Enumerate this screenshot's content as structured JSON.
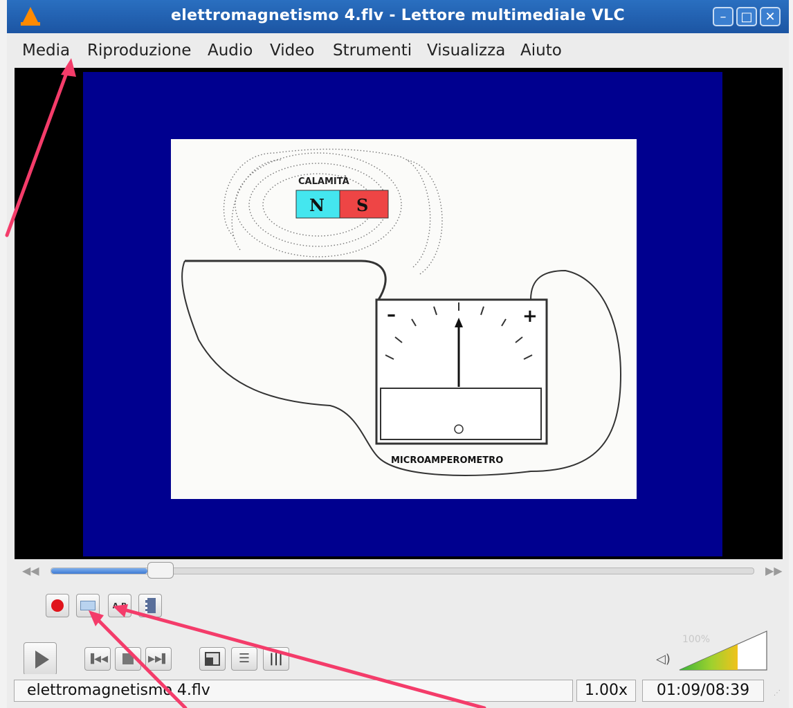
{
  "window": {
    "title": "elettromagnetismo 4.flv - Lettore multimediale VLC",
    "minimize": "–",
    "maximize": "□",
    "close": "✕"
  },
  "menu": [
    "Media",
    "Riproduzione",
    "Audio",
    "Video",
    "Strumenti",
    "Visualizza",
    "Aiuto"
  ],
  "slide": {
    "magnet_label": "CALAMITÀ",
    "north": "N",
    "south": "S",
    "meter_minus": "–",
    "meter_plus": "+",
    "meter_zero": "0",
    "meter_label": "MICROAMPEROMETRO"
  },
  "playback": {
    "progress": 0.137,
    "volume_label": "100%",
    "volume_level": 1.0
  },
  "status": {
    "filename": "elettromagnetismo 4.flv",
    "speed": "1.00x",
    "time": "01:09/08:39"
  },
  "colors": {
    "titlebar": "#1c55a3",
    "video_bg": "#00008f",
    "magnet_north": "#44e6ef",
    "magnet_south": "#ee4545",
    "annotation_arrow": "#f43c6a",
    "record": "#e0141b"
  },
  "icons": [
    "vlc-cone-icon",
    "record-icon",
    "snapshot-icon",
    "loop-ab-icon",
    "frame-by-frame-icon",
    "previous-icon",
    "stop-icon",
    "next-icon",
    "fullscreen-icon",
    "playlist-icon",
    "equalizer-icon",
    "speaker-icon",
    "skip-back-icon",
    "skip-forward-icon",
    "play-icon"
  ]
}
